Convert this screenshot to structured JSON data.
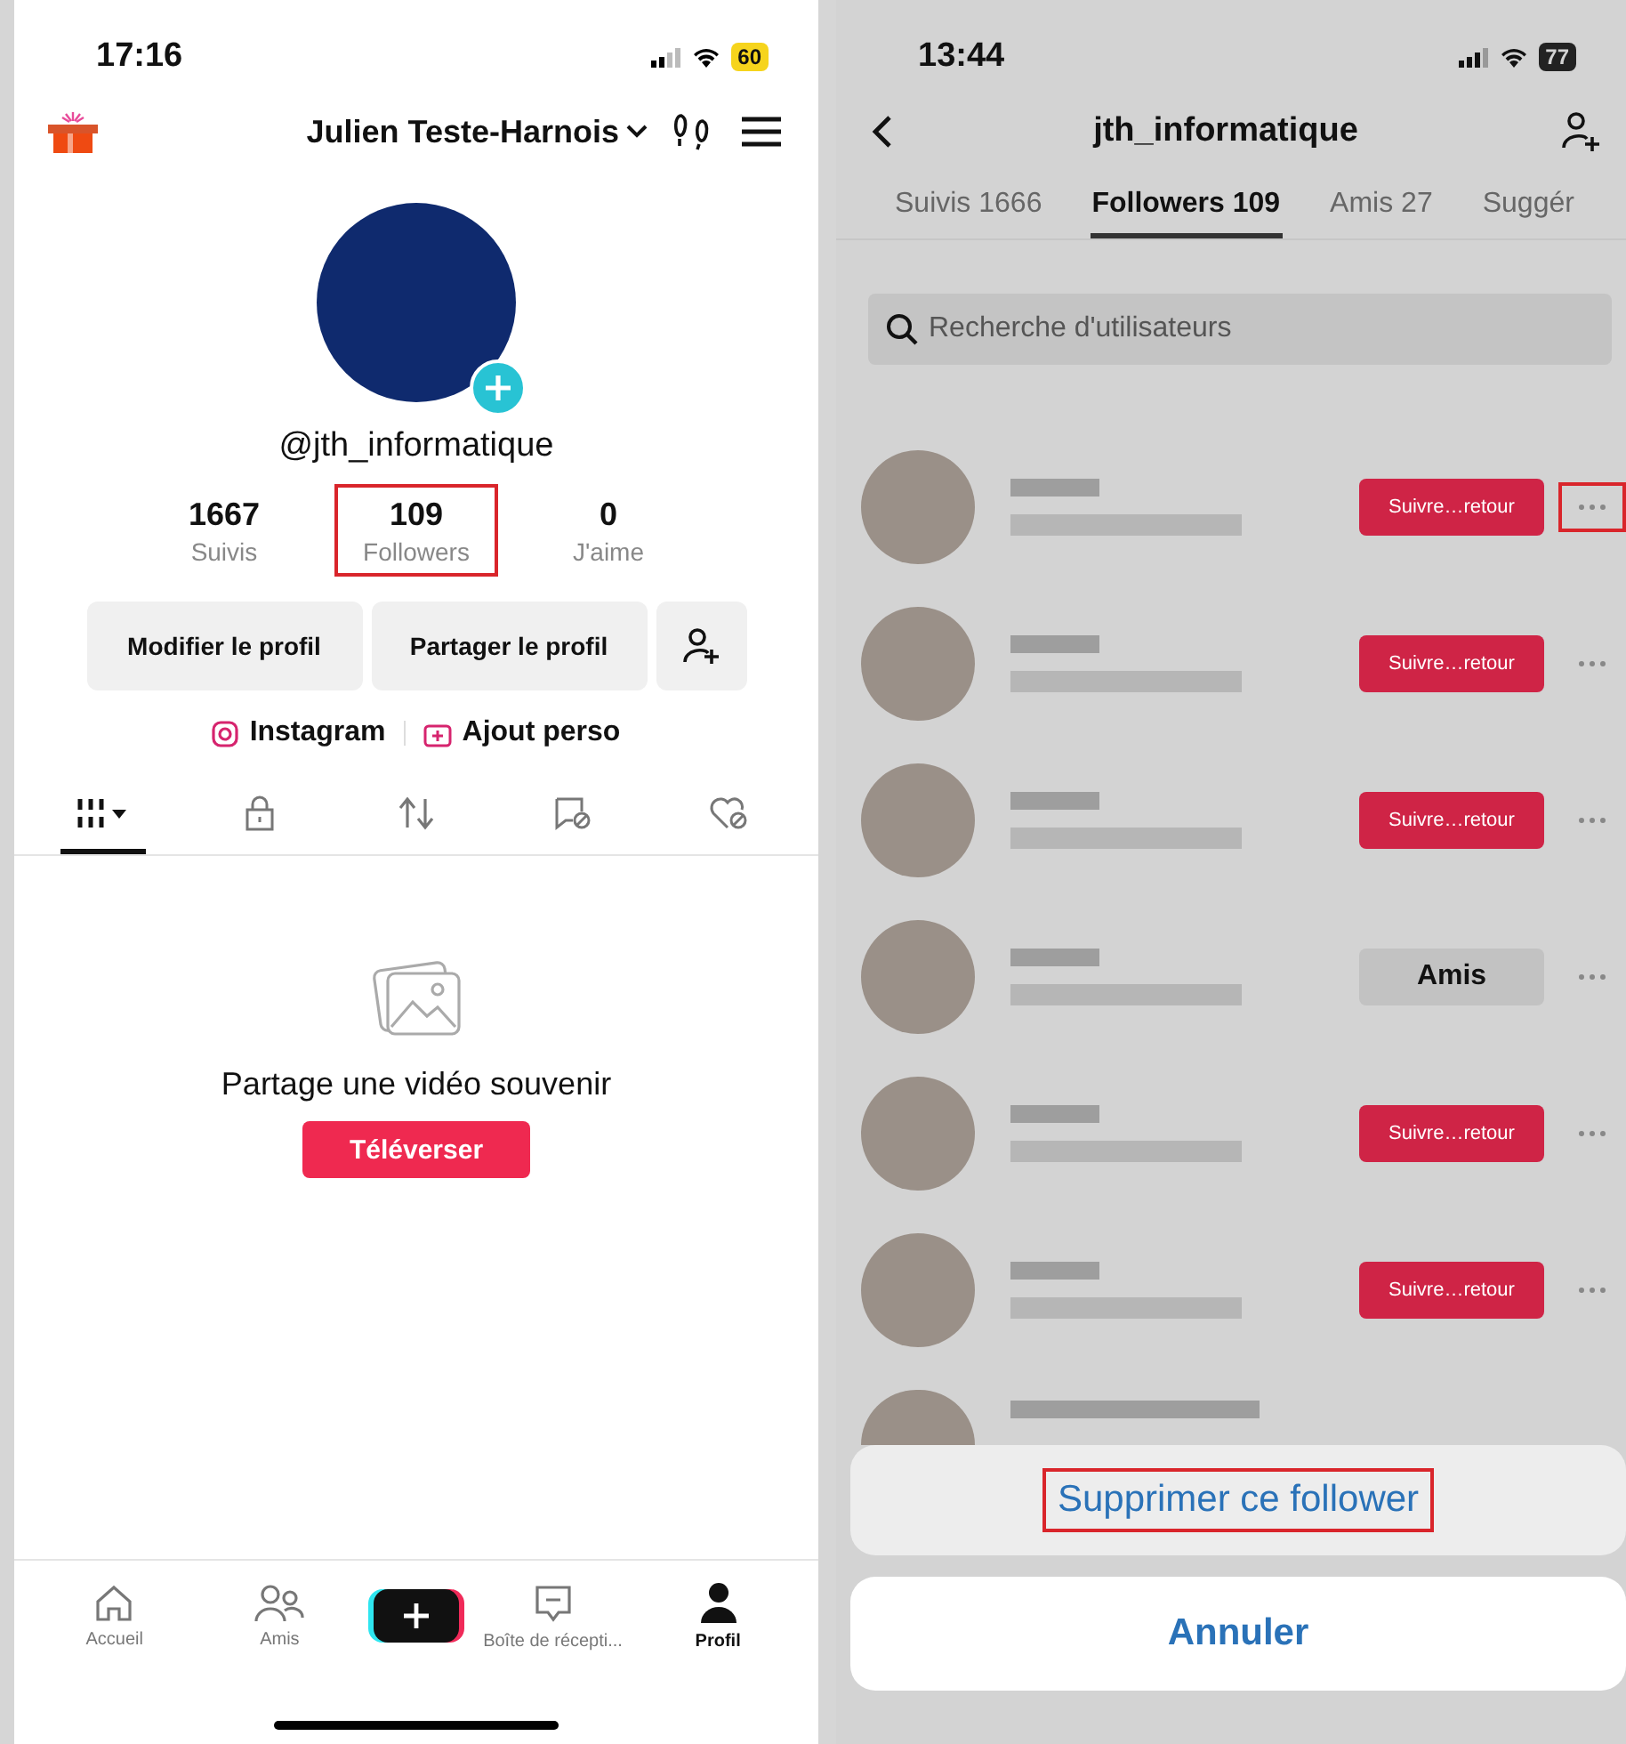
{
  "profile_screen": {
    "status_bar": {
      "time": "17:16",
      "battery": "60"
    },
    "header": {
      "name": "Julien Teste-Harnois"
    },
    "handle": "@jth_informatique",
    "stats": [
      {
        "value": "1667",
        "label": "Suivis",
        "highlighted": false
      },
      {
        "value": "109",
        "label": "Followers",
        "highlighted": true
      },
      {
        "value": "0",
        "label": "J'aime",
        "highlighted": false
      }
    ],
    "buttons": [
      "Modifier le profil",
      "Partager le profil"
    ],
    "links": [
      {
        "kind": "instagram",
        "label": "Instagram"
      },
      {
        "kind": "add",
        "label": "Ajout perso"
      }
    ],
    "content_tabs": [
      {
        "kind": "grid",
        "selected": true
      },
      {
        "kind": "lock",
        "selected": false
      },
      {
        "kind": "repost",
        "selected": false
      },
      {
        "kind": "saved",
        "selected": false
      },
      {
        "kind": "liked",
        "selected": false
      }
    ],
    "empty_state": {
      "message": "Partage une vidéo souvenir",
      "button": "Téléverser"
    },
    "bottom_nav": [
      {
        "kind": "home",
        "label": "Accueil",
        "selected": false
      },
      {
        "kind": "friends",
        "label": "Amis",
        "selected": false
      },
      {
        "kind": "create"
      },
      {
        "kind": "inbox",
        "label": "Boîte de récepti...",
        "selected": false
      },
      {
        "kind": "profile",
        "label": "Profil",
        "selected": true
      }
    ]
  },
  "followers_screen": {
    "status_bar": {
      "time": "13:44",
      "battery": "77"
    },
    "header": {
      "title": "jth_informatique"
    },
    "tabs": [
      {
        "label": "Suivis 1666",
        "selected": false
      },
      {
        "label": "Followers 109",
        "selected": true
      },
      {
        "label": "Amis 27",
        "selected": false
      },
      {
        "label": "Suggér",
        "selected": false
      }
    ],
    "search": {
      "placeholder": "Recherche d'utilisateurs"
    },
    "rows": [
      {
        "button": {
          "kind": "follow_back",
          "label": "Suivre…retour"
        },
        "more_highlighted": true
      },
      {
        "button": {
          "kind": "follow_back",
          "label": "Suivre…retour"
        },
        "more_highlighted": false
      },
      {
        "button": {
          "kind": "follow_back",
          "label": "Suivre…retour"
        },
        "more_highlighted": false
      },
      {
        "button": {
          "kind": "friends",
          "label": "Amis"
        },
        "more_highlighted": false
      },
      {
        "button": {
          "kind": "follow_back",
          "label": "Suivre…retour"
        },
        "more_highlighted": false
      },
      {
        "button": {
          "kind": "follow_back",
          "label": "Suivre…retour"
        },
        "more_highlighted": false
      }
    ],
    "action_sheet": {
      "actions": [
        {
          "label": "Supprimer ce follower",
          "highlighted": true
        }
      ],
      "cancel": "Annuler"
    }
  }
}
